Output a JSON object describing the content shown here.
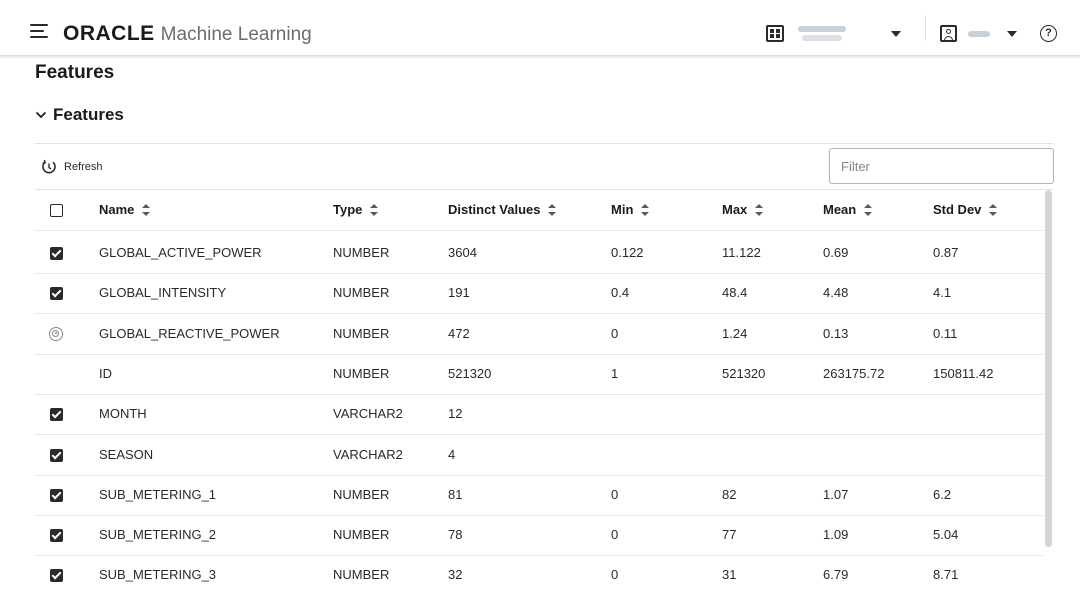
{
  "header": {
    "brand_oracle": "ORACLE",
    "brand_product": "Machine Learning",
    "project_name": "",
    "user_name": ""
  },
  "page": {
    "title": "Features",
    "section_title": "Features"
  },
  "toolbar": {
    "refresh_label": "Refresh",
    "filter_placeholder": "Filter"
  },
  "table": {
    "columns": [
      "Name",
      "Type",
      "Distinct Values",
      "Min",
      "Max",
      "Mean",
      "Std Dev"
    ],
    "rows": [
      {
        "selection": "checked",
        "name": "GLOBAL_ACTIVE_POWER",
        "type": "NUMBER",
        "distinct": "3604",
        "min": "0.122",
        "max": "11.122",
        "mean": "0.69",
        "std": "0.87"
      },
      {
        "selection": "checked",
        "name": "GLOBAL_INTENSITY",
        "type": "NUMBER",
        "distinct": "191",
        "min": "0.4",
        "max": "48.4",
        "mean": "4.48",
        "std": "4.1"
      },
      {
        "selection": "target",
        "name": "GLOBAL_REACTIVE_POWER",
        "type": "NUMBER",
        "distinct": "472",
        "min": "0",
        "max": "1.24",
        "mean": "0.13",
        "std": "0.11"
      },
      {
        "selection": "none",
        "name": "ID",
        "type": "NUMBER",
        "distinct": "521320",
        "min": "1",
        "max": "521320",
        "mean": "263175.72",
        "std": "150811.42"
      },
      {
        "selection": "checked",
        "name": "MONTH",
        "type": "VARCHAR2",
        "distinct": "12",
        "min": "",
        "max": "",
        "mean": "",
        "std": ""
      },
      {
        "selection": "checked",
        "name": "SEASON",
        "type": "VARCHAR2",
        "distinct": "4",
        "min": "",
        "max": "",
        "mean": "",
        "std": ""
      },
      {
        "selection": "checked",
        "name": "SUB_METERING_1",
        "type": "NUMBER",
        "distinct": "81",
        "min": "0",
        "max": "82",
        "mean": "1.07",
        "std": "6.2"
      },
      {
        "selection": "checked",
        "name": "SUB_METERING_2",
        "type": "NUMBER",
        "distinct": "78",
        "min": "0",
        "max": "77",
        "mean": "1.09",
        "std": "5.04"
      },
      {
        "selection": "checked",
        "name": "SUB_METERING_3",
        "type": "NUMBER",
        "distinct": "32",
        "min": "0",
        "max": "31",
        "mean": "6.79",
        "std": "8.71"
      }
    ]
  },
  "colors": {
    "text": "#161513",
    "muted": "#6f6c68",
    "border": "#e4e2df",
    "scroll_thumb": "#d7d5d2"
  }
}
